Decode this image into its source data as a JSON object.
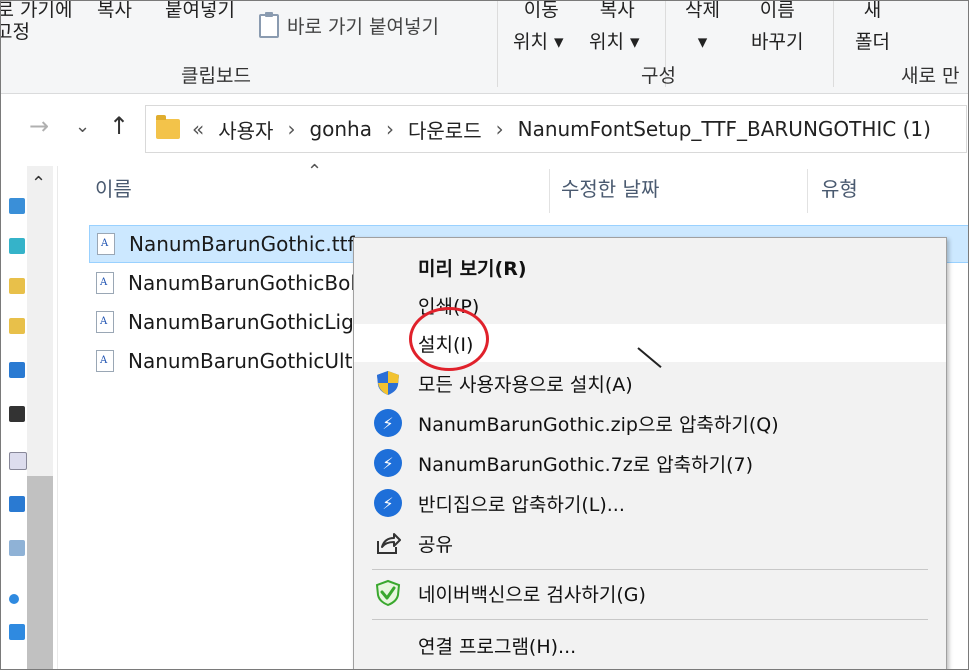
{
  "ribbon": {
    "pin_line1": "바로 가기에",
    "pin_line2": "고정",
    "copy": "복사",
    "paste": "붙여넣기",
    "paste_shortcut": "바로 가기 붙여넣기",
    "move_line1": "이동",
    "move_line2": "위치 ▾",
    "copyto_line1": "복사",
    "copyto_line2": "위치 ▾",
    "delete_line1": "삭제",
    "delete_line2": "▾",
    "rename_line1": "이름",
    "rename_line2": "바꾸기",
    "newfolder_line1": "새",
    "newfolder_line2": "폴더",
    "group_clipboard": "클립보드",
    "group_organize": "구성",
    "group_new": "새로 만"
  },
  "nav": {
    "back": "←",
    "forward": "→",
    "recent": "⌄",
    "up": "↑"
  },
  "address": {
    "overflow": "«",
    "crumbs": [
      "사용자",
      "gonha",
      "다운로드",
      "NanumFontSetup_TTF_BARUNGOTHIC (1)"
    ]
  },
  "columns": {
    "name": "이름",
    "modified": "수정한 날짜",
    "type": "유형"
  },
  "files": [
    {
      "name": "NanumBarunGothic.ttf",
      "selected": true
    },
    {
      "name": "NanumBarunGothicBold.ttf",
      "selected": false
    },
    {
      "name": "NanumBarunGothicLight.ttf",
      "selected": false
    },
    {
      "name": "NanumBarunGothicUltraLight.ttf",
      "selected": false
    }
  ],
  "context_menu": {
    "items": [
      {
        "label": "미리 보기(R)",
        "bold": true,
        "icon": ""
      },
      {
        "label": "인쇄(P)",
        "bold": false,
        "icon": ""
      },
      {
        "label": "설치(I)",
        "bold": false,
        "icon": ""
      },
      {
        "label": "모든 사용자용으로 설치(A)",
        "bold": false,
        "icon": "uac-shield-icon"
      },
      {
        "label": "NanumBarunGothic.zip으로 압축하기(Q)",
        "bold": false,
        "icon": "bandizip-icon"
      },
      {
        "label": "NanumBarunGothic.7z로 압축하기(7)",
        "bold": false,
        "icon": "bandizip-icon"
      },
      {
        "label": "반디집으로 압축하기(L)...",
        "bold": false,
        "icon": "bandizip-icon"
      },
      {
        "label": "공유",
        "bold": false,
        "icon": "share-icon"
      },
      {
        "label": "네이버백신으로 검사하기(G)",
        "bold": false,
        "icon": "naver-vaccine-icon"
      },
      {
        "label": "연결 프로그램(H)...",
        "bold": false,
        "icon": ""
      }
    ]
  },
  "colors": {
    "selection_bg": "#cce8ff",
    "highlight_circle": "#e0212b",
    "bandizip_blue": "#1e6fd9"
  }
}
